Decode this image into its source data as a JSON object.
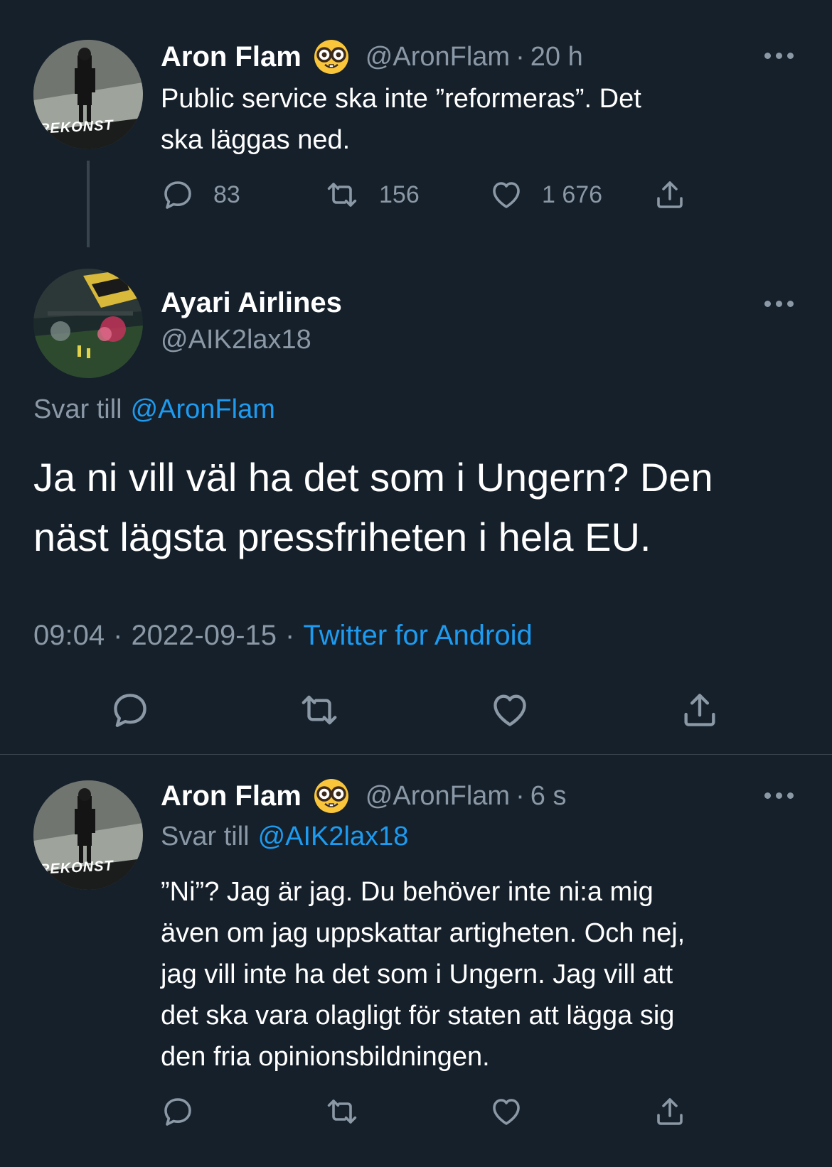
{
  "colors": {
    "background": "#15202b",
    "text": "#ffffff",
    "muted": "#8b98a5",
    "link": "#1d9bf0",
    "divider": "#38444d"
  },
  "tweet1": {
    "name": "Aron Flam",
    "emoji_icon": "nerd-face-emoji",
    "handle": "@AronFlam",
    "separator": "·",
    "time": "20 h",
    "text_line1": "Public service ska inte ”reformeras”. Det",
    "text_line2": "ska läggas ned.",
    "replies": "83",
    "retweets": "156",
    "likes": "1 676"
  },
  "main_tweet": {
    "name": "Ayari Airlines",
    "handle": "@AIK2lax18",
    "reply_prefix": "Svar till",
    "reply_handle": "@AronFlam",
    "text_line1": "Ja ni vill väl ha det som i Ungern? Den",
    "text_line2": "näst lägsta pressfriheten i hela EU.",
    "time": "09:04",
    "separator": "·",
    "date": "2022-09-15",
    "source": "Twitter for Android"
  },
  "tweet3": {
    "name": "Aron Flam",
    "emoji_icon": "nerd-face-emoji",
    "handle": "@AronFlam",
    "separator": "·",
    "time": "6 s",
    "reply_prefix": "Svar till",
    "reply_handle": "@AIK2lax18",
    "lines": [
      "”Ni”? Jag är jag. Du behöver inte ni:a mig",
      "även om jag uppskattar artigheten. Och nej,",
      "jag vill inte ha det som i Ungern. Jag vill att",
      "det ska vara olagligt för staten att lägga sig",
      "den fria opinionsbildningen."
    ]
  },
  "avatar_text": "REKONST"
}
